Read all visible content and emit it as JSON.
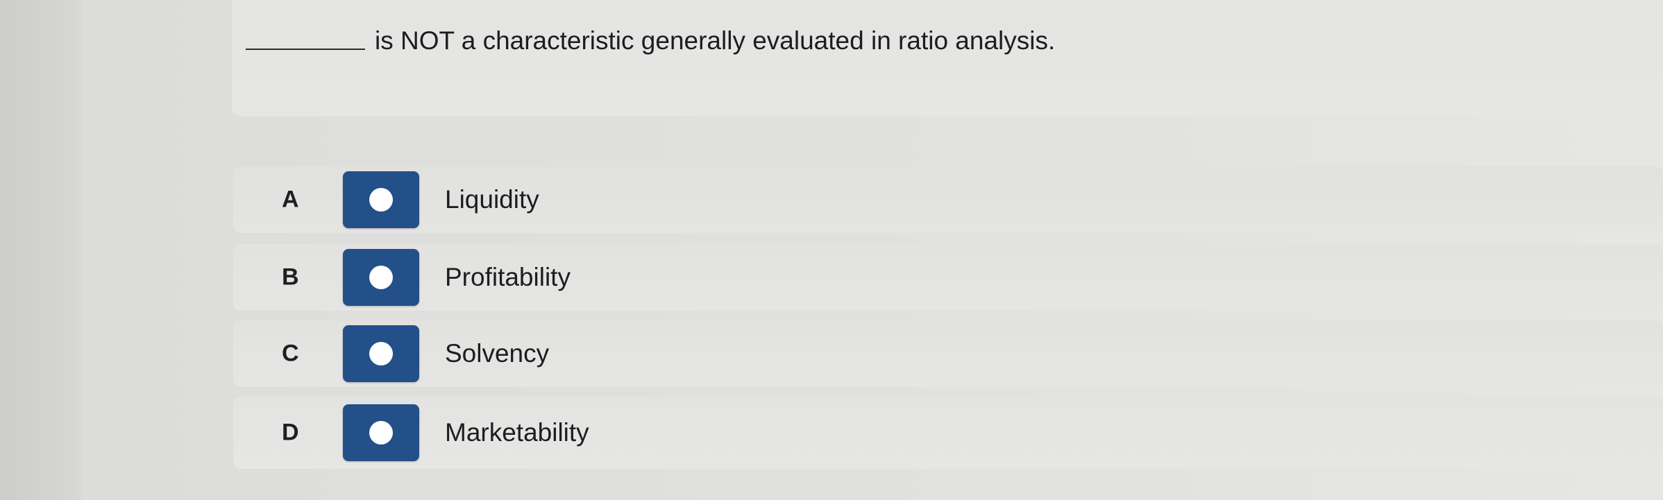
{
  "question": {
    "text": "is NOT a characteristic generally evaluated in ratio analysis."
  },
  "options": [
    {
      "letter": "A",
      "label": "Liquidity"
    },
    {
      "letter": "B",
      "label": "Profitability"
    },
    {
      "letter": "C",
      "label": "Solvency"
    },
    {
      "letter": "D",
      "label": "Marketability"
    }
  ],
  "colors": {
    "radio_fill": "#245089",
    "radio_dot": "#ffffff"
  }
}
